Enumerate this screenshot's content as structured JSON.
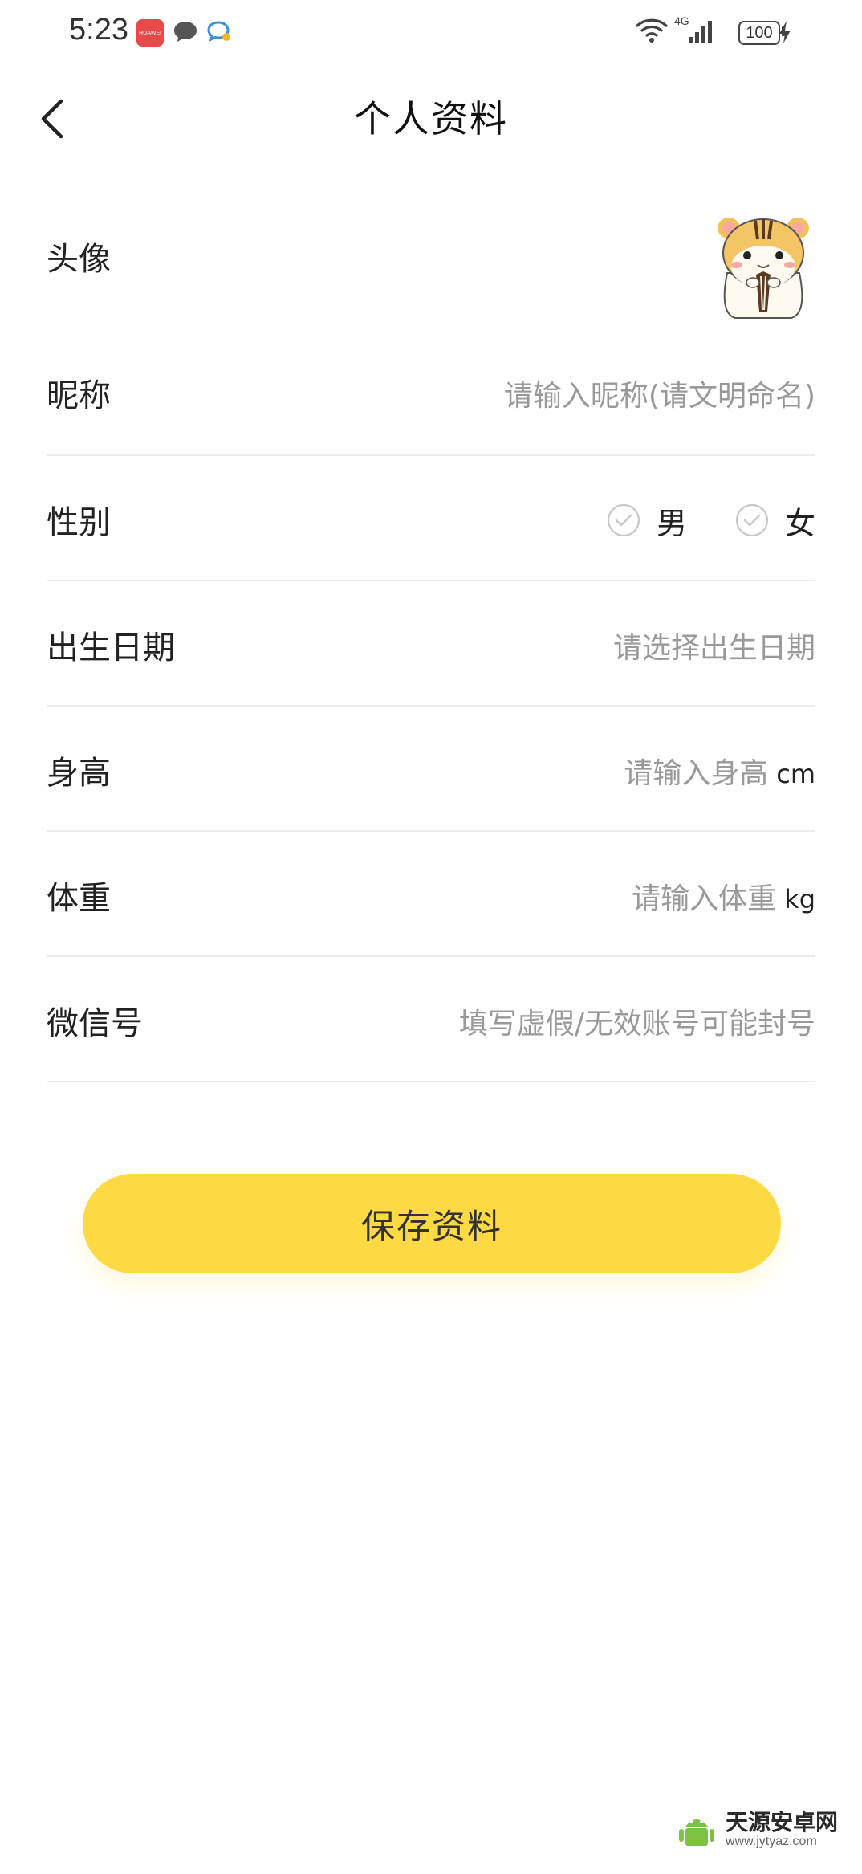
{
  "status_bar": {
    "time": "5:23",
    "network": "4G",
    "battery": "100"
  },
  "header": {
    "title": "个人资料"
  },
  "form": {
    "avatar_label": "头像",
    "nickname_label": "昵称",
    "nickname_placeholder": "请输入昵称(请文明命名)",
    "gender_label": "性别",
    "gender_options": [
      "男",
      "女"
    ],
    "birthday_label": "出生日期",
    "birthday_placeholder": "请选择出生日期",
    "height_label": "身高",
    "height_placeholder": "请输入身高",
    "height_unit": "cm",
    "weight_label": "体重",
    "weight_placeholder": "请输入体重",
    "weight_unit": "kg",
    "wechat_label": "微信号",
    "wechat_placeholder": "填写虚假/无效账号可能封号"
  },
  "actions": {
    "save_label": "保存资料"
  },
  "watermark": {
    "main": "天源安卓网",
    "sub": "www.jytyaz.com"
  },
  "colors": {
    "accent": "#fdd944",
    "placeholder": "#999999",
    "divider": "#ececec"
  }
}
